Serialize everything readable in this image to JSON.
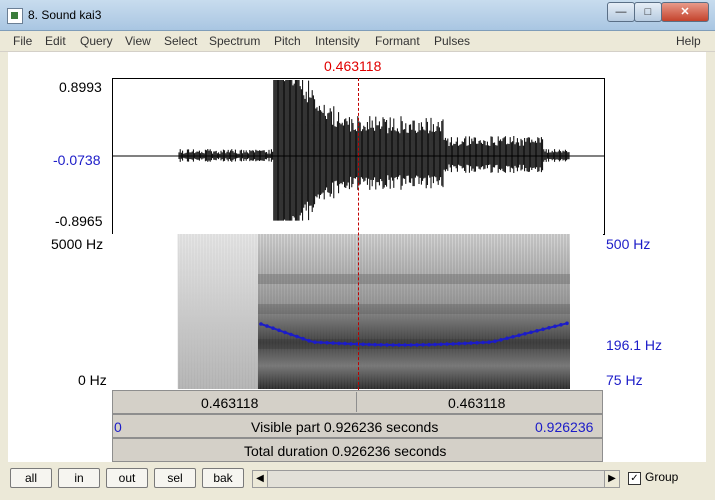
{
  "window": {
    "title": "8. Sound kai3",
    "icon": "praat-sound-icon"
  },
  "menu": [
    "File",
    "Edit",
    "Query",
    "View",
    "Select",
    "Spectrum",
    "Pitch",
    "Intensity",
    "Formant",
    "Pulses",
    "Help"
  ],
  "cursor": {
    "time": "0.463118"
  },
  "waveform": {
    "max_label": "0.8993",
    "cursor_value": "-0.0738",
    "min_label": "-0.8965"
  },
  "spectrogram": {
    "freq_top": "5000 Hz",
    "freq_bottom": "0 Hz",
    "pitch_top": "500 Hz",
    "pitch_value": "196.1 Hz",
    "pitch_bottom": "75 Hz"
  },
  "time_bars": {
    "left_interval": "0.463118",
    "right_interval": "0.463118",
    "visible_start": "0",
    "visible_text": "Visible part 0.926236 seconds",
    "visible_end": "0.926236",
    "total_text": "Total duration 0.926236 seconds"
  },
  "toolbar": {
    "buttons": [
      "all",
      "in",
      "out",
      "sel",
      "bak"
    ],
    "group_label": "Group",
    "group_checked": true
  },
  "colors": {
    "cursor": "#e00000",
    "pitch_curve": "#1c1cc8",
    "axis_blue": "#1c1cc8"
  }
}
